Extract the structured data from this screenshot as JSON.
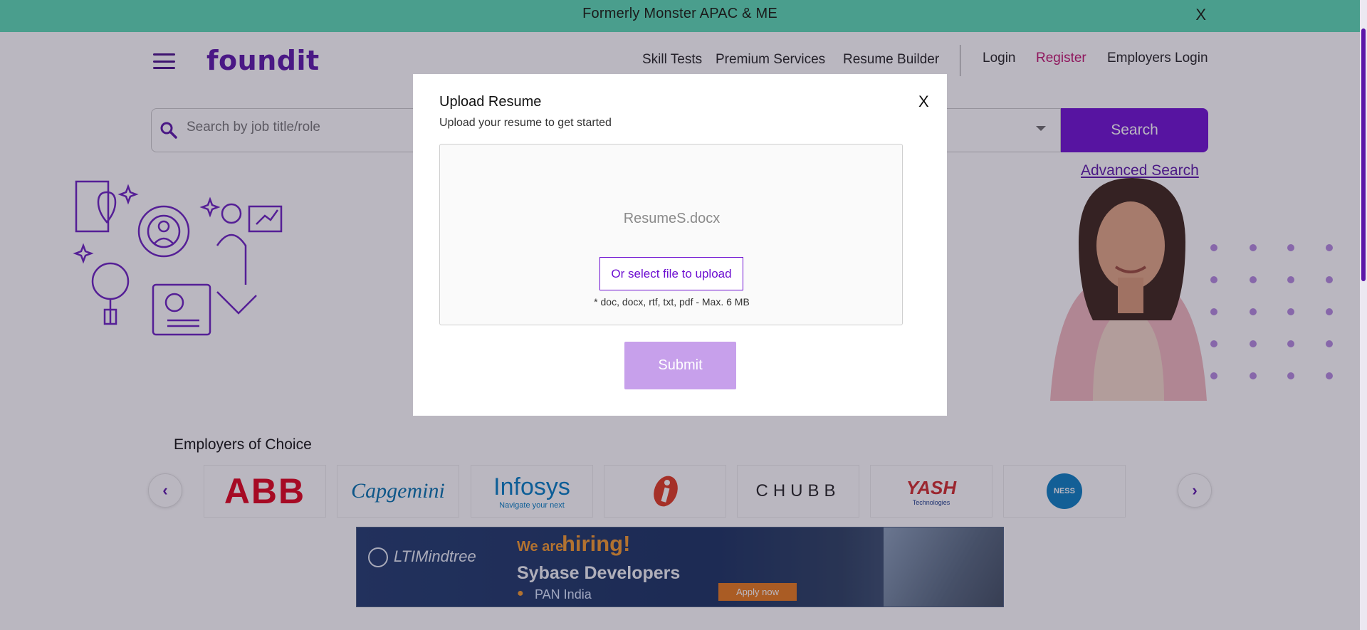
{
  "banner": {
    "message": "Formerly Monster APAC & ME",
    "close_label": "X"
  },
  "header": {
    "logo": "foundit",
    "nav": [
      "Skill Tests",
      "Premium Services",
      "Resume Builder"
    ],
    "login": "Login",
    "register": "Register",
    "employers_login": "Employers Login"
  },
  "search": {
    "placeholder": "Search by job title/role",
    "button": "Search",
    "advanced": "Advanced Search"
  },
  "employers": {
    "title": "Employers of Choice",
    "logos": [
      "ABB",
      "Capgemini",
      "Infosys",
      "ICICI",
      "CHUBB",
      "YASH",
      "NESS"
    ],
    "infosys_tagline": "Navigate your next",
    "yash_tagline": "Technologies"
  },
  "ad": {
    "brand": "LTIMindtree",
    "we_are": "We are",
    "hiring": "hiring!",
    "role": "Sybase Developers",
    "location": "PAN India",
    "cta": "Apply now"
  },
  "modal": {
    "title": "Upload Resume",
    "subtitle": "Upload your resume to get started",
    "close_label": "X",
    "file_name": "ResumeS.docx",
    "select_button": "Or select file to upload",
    "formats": "* doc, docx, rtf, txt, pdf - Max. 6 MB",
    "submit": "Submit"
  },
  "colors": {
    "brand_purple": "#6d0fd1",
    "register_pink": "#c0136e",
    "banner_teal": "#4a9e8d",
    "submit_disabled": "#c7a0eb"
  },
  "icons": {
    "menu": "hamburger-icon",
    "search": "search-icon",
    "dropdown": "chevron-down-icon",
    "prev": "chevron-left-icon",
    "next": "chevron-right-icon"
  }
}
